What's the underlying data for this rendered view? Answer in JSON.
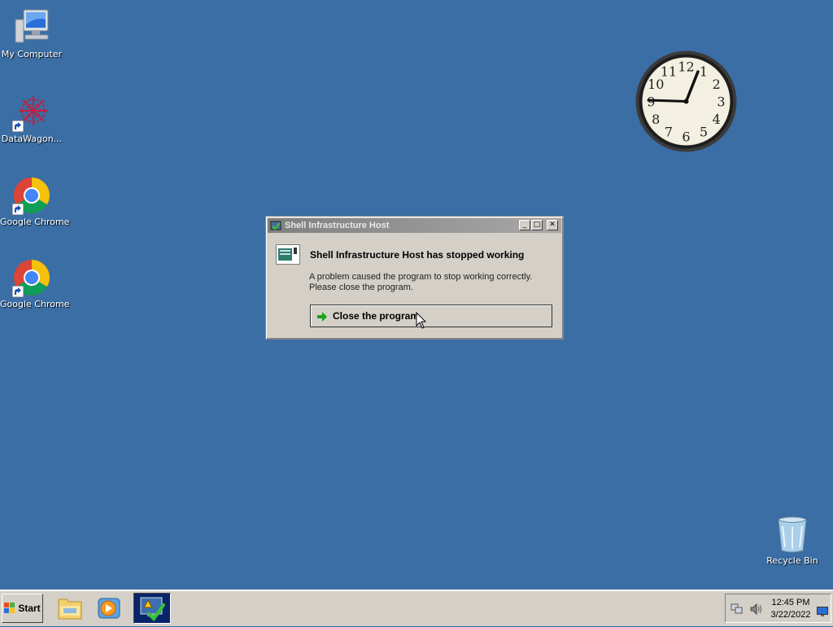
{
  "desktop": {
    "icons": [
      {
        "label": "My Computer",
        "icon": "my-computer-icon"
      },
      {
        "label": "DataWagon...",
        "icon": "datawagon-icon"
      },
      {
        "label": "Google Chrome",
        "icon": "chrome-icon"
      },
      {
        "label": "Google Chrome",
        "icon": "chrome-icon"
      },
      {
        "label": "Recycle Bin",
        "icon": "recycle-bin-icon"
      }
    ]
  },
  "clock_gadget": {
    "numerals": [
      "12",
      "1",
      "2",
      "3",
      "4",
      "5",
      "6",
      "7",
      "8",
      "9",
      "10",
      "11"
    ],
    "time": "12:45"
  },
  "dialog": {
    "title": "Shell Infrastructure Host",
    "headline": "Shell Infrastructure Host has stopped working",
    "body_line1": "A problem caused the program to stop working correctly.",
    "body_line2": "Please close the program.",
    "close_program_label": "Close the program",
    "minimize_glyph": "_",
    "maximize_glyph": "□",
    "close_glyph": "✕"
  },
  "taskbar": {
    "start_label": "Start",
    "items": [
      "file-explorer-icon",
      "media-player-icon",
      "action-center-icon"
    ],
    "clock_time": "12:45 PM",
    "clock_date": "3/22/2022"
  },
  "colors": {
    "desktop": "#3a6ea5",
    "dialog_face": "#d4d0c8",
    "arrow_green": "#1ca21c"
  }
}
